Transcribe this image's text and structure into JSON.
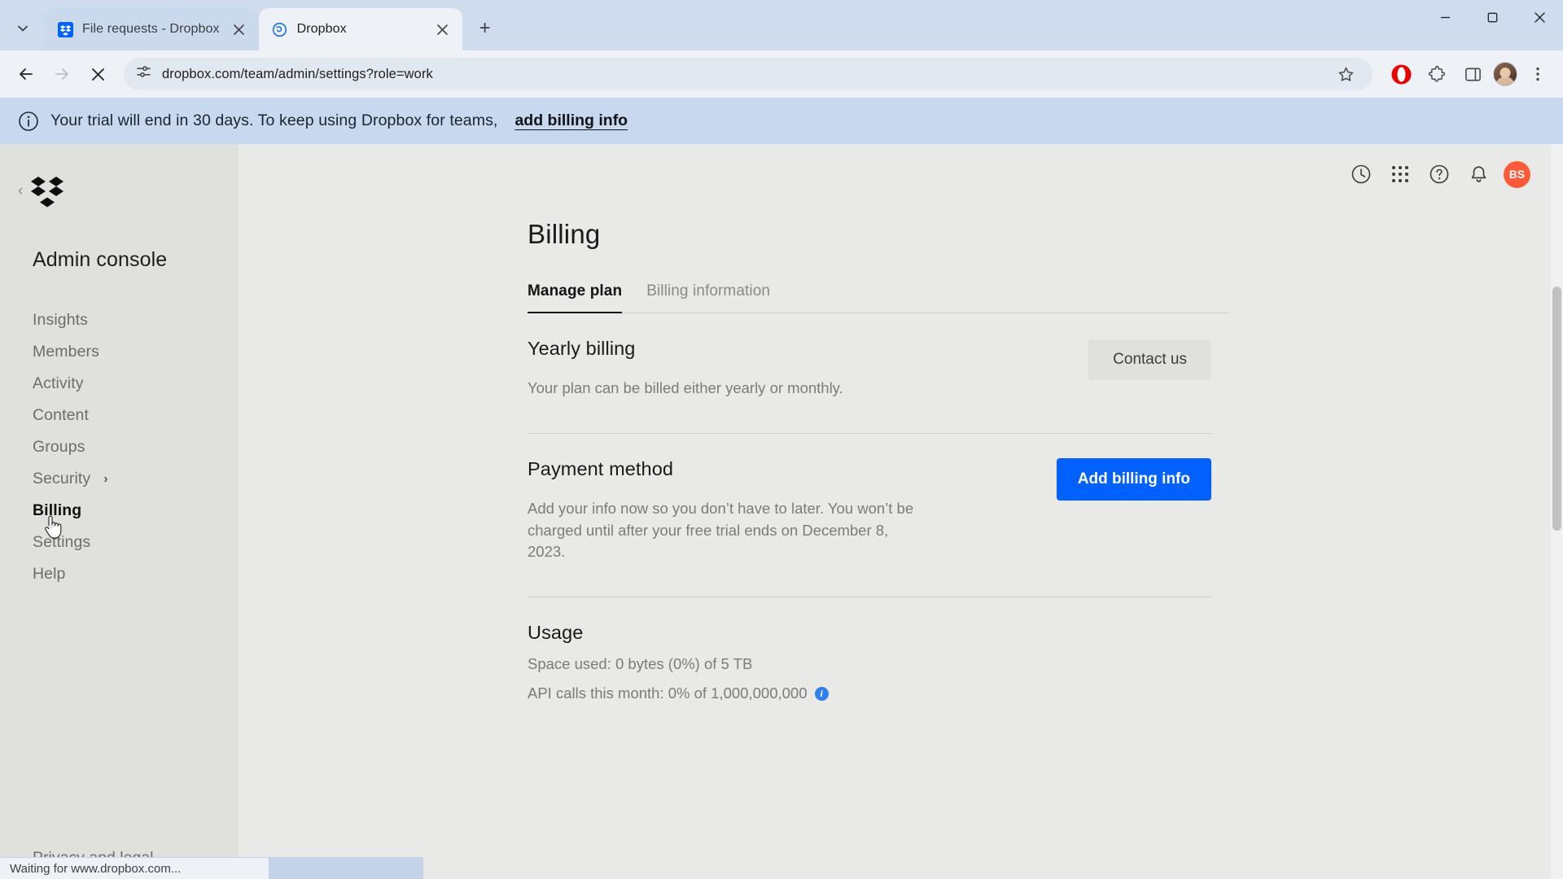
{
  "browser": {
    "tabs": [
      {
        "title": "File requests - Dropbox",
        "favicon": "dropbox-blue-icon",
        "active": false
      },
      {
        "title": "Dropbox",
        "favicon": "dropbox-loading-icon",
        "active": true
      }
    ],
    "tab_list_button": "tab-search-icon",
    "new_tab_button": "+",
    "window_controls": {
      "minimize": "−",
      "maximize": "□",
      "close": "✕"
    },
    "nav": {
      "back": "back-icon",
      "forward": "forward-icon",
      "stop": "stop-loading-icon"
    },
    "omnibox": {
      "url": "dropbox.com/team/admin/settings?role=work",
      "site_info_icon": "page-settings-icon",
      "bookmark_icon": "star-icon"
    },
    "extensions": [
      "opera-extension-icon",
      "extensions-puzzle-icon",
      "side-panel-icon"
    ],
    "profile": "profile-avatar",
    "menu": "chrome-menu-icon",
    "status_text": "Waiting for www.dropbox.com..."
  },
  "banner": {
    "icon": "info-circle-icon",
    "text": "Your trial will end in 30 days. To keep using Dropbox for teams,",
    "link_label": "add billing info"
  },
  "sidebar": {
    "logo": "dropbox-logo",
    "collapse_icon": "chevron-left-icon",
    "title": "Admin console",
    "items": [
      {
        "label": "Insights",
        "active": false,
        "expandable": false
      },
      {
        "label": "Members",
        "active": false,
        "expandable": false
      },
      {
        "label": "Activity",
        "active": false,
        "expandable": false
      },
      {
        "label": "Content",
        "active": false,
        "expandable": false
      },
      {
        "label": "Groups",
        "active": false,
        "expandable": false
      },
      {
        "label": "Security",
        "active": false,
        "expandable": true,
        "chevron": "›"
      },
      {
        "label": "Billing",
        "active": true,
        "expandable": false
      },
      {
        "label": "Settings",
        "active": false,
        "expandable": false
      },
      {
        "label": "Help",
        "active": false,
        "expandable": false
      }
    ],
    "footer_link": "Privacy and legal"
  },
  "topbar": {
    "icons": [
      "clock-history-icon",
      "apps-grid-icon",
      "help-circle-icon",
      "bell-notification-icon"
    ],
    "avatar_initials": "BS",
    "avatar_color": "#ff5b3a"
  },
  "page": {
    "title": "Billing",
    "tabs": [
      {
        "label": "Manage plan",
        "active": true
      },
      {
        "label": "Billing information",
        "active": false
      }
    ],
    "sections": [
      {
        "title": "Yearly billing",
        "description": "Your plan can be billed either yearly or monthly.",
        "action": {
          "label": "Contact us",
          "style": "secondary"
        }
      },
      {
        "title": "Payment method",
        "description": "Add your info now so you don’t have to later. You won’t be charged until after your free trial ends on December 8, 2023.",
        "action": {
          "label": "Add billing info",
          "style": "primary"
        }
      },
      {
        "title": "Usage",
        "lines": [
          {
            "text": "Space used: 0 bytes (0%) of 5 TB",
            "info": false
          },
          {
            "text": "API calls this month: 0% of 1,000,000,000",
            "info": true
          }
        ]
      }
    ]
  },
  "colors": {
    "accent": "#0061fe",
    "banner_bg": "#c8d9ef",
    "sidebar_bg": "#e0e0dc",
    "content_bg": "#e9e9e7"
  }
}
